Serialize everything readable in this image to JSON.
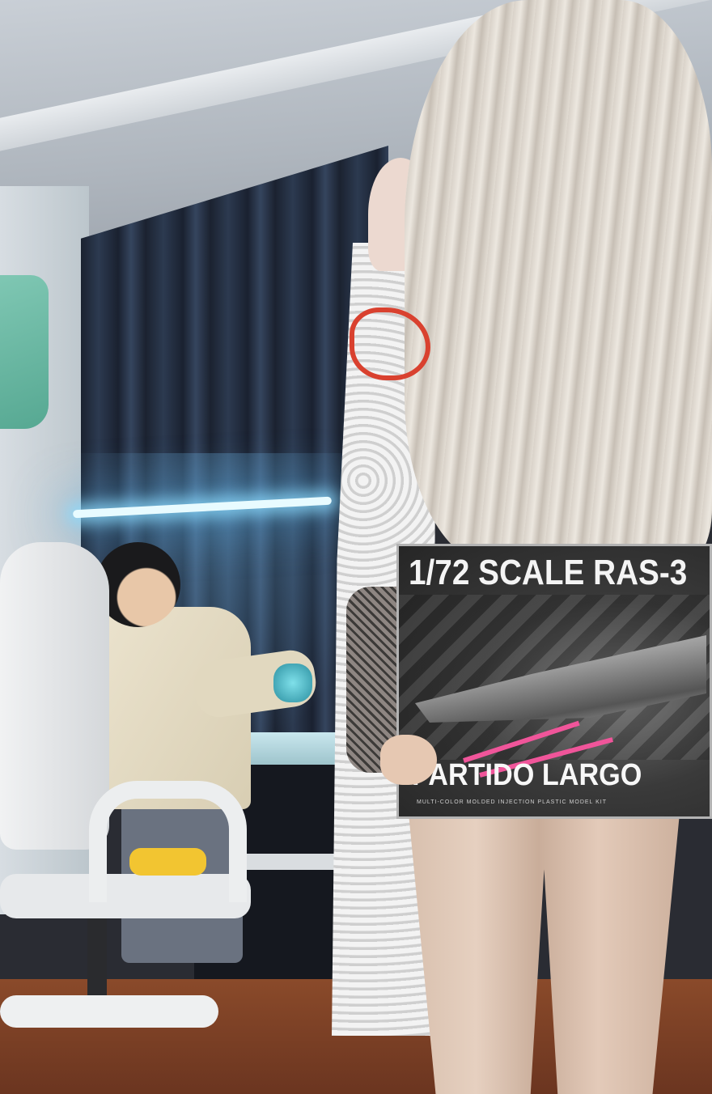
{
  "box": {
    "title_top": "1/72 SCALE RAS-3",
    "title_bottom": "PARTIDO LARGO",
    "subline": "MULTI-COLOR MOLDED INJECTION PLASTIC MODEL KIT"
  },
  "colors": {
    "curtain": "#1b2230",
    "hair": "#e2dcd3",
    "floor": "#7a4026",
    "chair": "#eceeef",
    "cushion": "#f2c531",
    "light": "#8cdcff",
    "ribbon": "#d9412f",
    "beam": "#f0559a"
  }
}
